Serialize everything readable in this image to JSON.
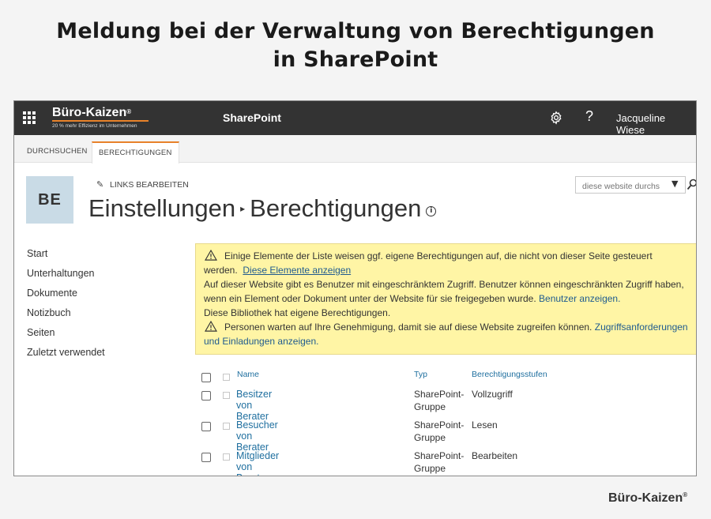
{
  "heading": {
    "line1": "Meldung bei der Verwaltung von Berechtigungen",
    "line2": "in SharePoint"
  },
  "suitebar": {
    "logo_name": "Büro-Kaizen",
    "logo_reg": "®",
    "logo_tagline": "20 % mehr Effizienz im Unternehmen",
    "app_name": "SharePoint",
    "help": "?",
    "user": "Jacqueline Wiese"
  },
  "ribbon": {
    "tabs": [
      {
        "label": "DURCHSUCHEN"
      },
      {
        "label": "BERECHTIGUNGEN"
      }
    ]
  },
  "site": {
    "logo_initials": "BE",
    "edit_links": "LINKS BEARBEITEN",
    "title_part1": "Einstellungen",
    "title_sep": "▸",
    "title_part2": "Berechtigungen",
    "search_placeholder": "diese website durchs"
  },
  "nav": {
    "items": [
      {
        "label": "Start"
      },
      {
        "label": "Unterhaltungen"
      },
      {
        "label": "Dokumente"
      },
      {
        "label": "Notizbuch"
      },
      {
        "label": "Seiten"
      },
      {
        "label": "Zuletzt verwendet"
      }
    ]
  },
  "notice": {
    "msg1_text": "Einige Elemente der Liste weisen ggf. eigene Berechtigungen auf, die nicht von dieser Seite gesteuert werden.",
    "msg1_link": "Diese Elemente anzeigen",
    "msg2_text": "Auf dieser Website gibt es Benutzer mit eingeschränktem Zugriff. Benutzer können eingeschränkten Zugriff haben, wenn ein Element oder Dokument unter der Website für sie freigegeben wurde.",
    "msg2_link": "Benutzer anzeigen.",
    "msg3_text": "Diese Bibliothek hat eigene Berechtigungen.",
    "msg4_text": "Personen warten auf Ihre Genehmigung, damit sie auf diese Website zugreifen können.",
    "msg4_link": "Zugriffsanforderungen und Einladungen anzeigen."
  },
  "table": {
    "columns": {
      "name": "Name",
      "type": "Typ",
      "level": "Berechtigungsstufen"
    },
    "rows": [
      {
        "name": "Besitzer von Berater",
        "type_line1": "SharePoint-",
        "type_line2": "Gruppe",
        "level": "Vollzugriff"
      },
      {
        "name": "Besucher von Berater",
        "type_line1": "SharePoint-",
        "type_line2": "Gruppe",
        "level": "Lesen"
      },
      {
        "name": "Mitglieder von Berater",
        "type_line1": "SharePoint-",
        "type_line2": "Gruppe",
        "level": "Bearbeiten"
      }
    ]
  },
  "footer": {
    "logo_name": "Büro-Kaizen",
    "logo_reg": "®"
  },
  "colors": {
    "suitebar": "#333333",
    "accent": "#e8822a",
    "notice_bg": "#fff5a5",
    "link": "#1f6f9f"
  }
}
